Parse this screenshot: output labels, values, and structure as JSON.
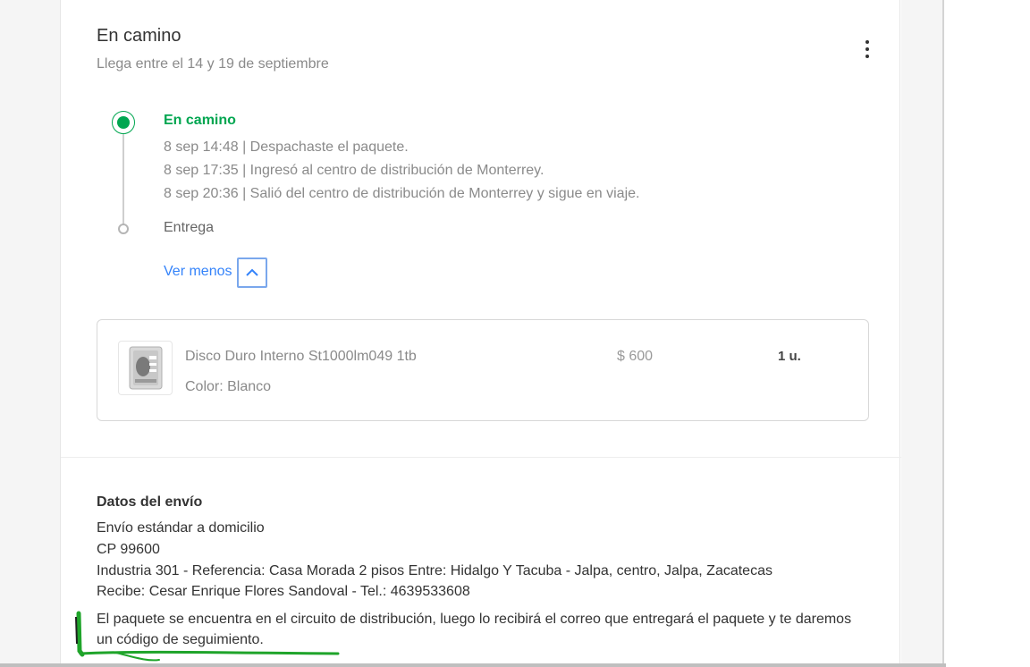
{
  "status": {
    "title": "En camino",
    "subtitle": "Llega entre el 14 y 19 de septiembre",
    "colors": {
      "accent": "#00a650",
      "link": "#3483fa"
    }
  },
  "timeline": {
    "current_label": "En camino",
    "events": [
      "8 sep 14:48 | Despachaste el paquete.",
      "8 sep 17:35 | Ingresó al centro de distribución de Monterrey.",
      "8 sep 20:36 | Salió del centro de distribución de Monterrey y sigue en viaje."
    ],
    "next_label": "Entrega",
    "toggle_label": "Ver menos"
  },
  "product": {
    "name": "Disco Duro Interno St1000lm049 1tb",
    "color": "Color: Blanco",
    "price": "$ 600",
    "quantity": "1 u."
  },
  "shipping": {
    "title": "Datos del envío",
    "lines": [
      "Envío estándar a domicilio",
      "CP 99600",
      "Industria 301 - Referencia: Casa Morada 2 pisos Entre: Hidalgo Y Tacuba - Jalpa, centro, Jalpa, Zacatecas",
      "Recibe: Cesar Enrique Flores Sandoval - Tel.: 4639533608"
    ],
    "note": "El paquete se encuentra en el circuito de distribución, luego lo recibirá el correo que entregará el paquete y te daremos un código de seguimiento."
  },
  "icons": {
    "menu": "kebab-menu-icon",
    "toggle": "chevron-up-icon",
    "product": "hard-drive-thumbnail"
  }
}
